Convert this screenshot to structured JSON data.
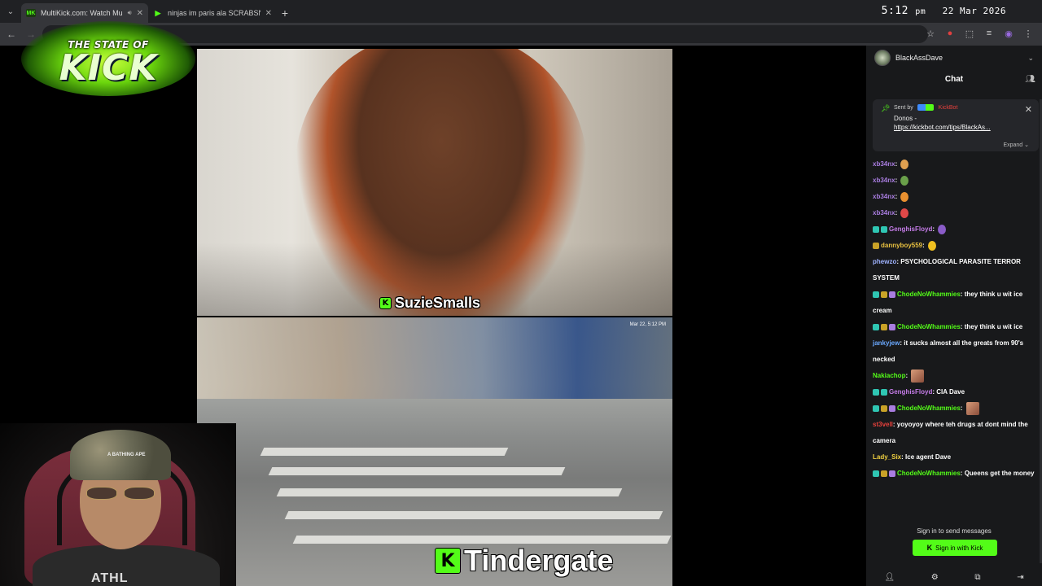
{
  "browser": {
    "tabs": [
      {
        "title": "MultiKick.com: Watch Multi",
        "favicon": "MK",
        "active": true
      },
      {
        "title": "ninjas im paris ala SCRABSNYC",
        "favicon": "play-icon",
        "active": false
      }
    ],
    "clock": {
      "time_hm": "5:12",
      "ampm": "pm",
      "date": "22 Mar 2026"
    }
  },
  "logo": {
    "top_text": "THE STATE OF",
    "big_text": "KICK"
  },
  "streams": {
    "top_name": "SuzieSmalls",
    "bottom_name": "Tindergate",
    "bottom_stamp": "Mar 22, 5:12 PM",
    "k_badge": "K"
  },
  "webcam": {
    "hat_text": "A BATHING APE",
    "shirt_text": "ATHL"
  },
  "chat": {
    "username": "BlackAssDave",
    "title": "Chat",
    "pinned": {
      "sent_by": "Sent by",
      "bot_name": "KickBot",
      "message": "Donos -",
      "link": "https://kickbot.com/tips/BlackAs...",
      "expand": "Expand"
    },
    "messages": [
      {
        "user": "xb34nx",
        "color": "#a97de0",
        "badges": [],
        "text": "",
        "emote": "#e0a050"
      },
      {
        "user": "xb34nx",
        "color": "#a97de0",
        "badges": [],
        "text": "",
        "emote": "#6aa04a"
      },
      {
        "user": "xb34nx",
        "color": "#a97de0",
        "badges": [],
        "text": "",
        "emote": "#e89030"
      },
      {
        "user": "xb34nx",
        "color": "#a97de0",
        "badges": [],
        "text": "",
        "emote": "#e04848"
      },
      {
        "user": "GenghisFloyd",
        "color": "#c57ce8",
        "badges": [
          "teal",
          "teal"
        ],
        "text": "",
        "emote": "#8a5cc8"
      },
      {
        "user": "dannyboy559",
        "color": "#e8c040",
        "badges": [
          "gold"
        ],
        "text": "",
        "emote": "#f0c020"
      },
      {
        "user": "phewzo",
        "color": "#9fb3ff",
        "badges": [],
        "text": "PSYCHOLOGICAL PARASITE TERROR SYSTEM",
        "emote": ""
      },
      {
        "user": "ChodeNoWhammies",
        "color": "#53fc18",
        "badges": [
          "teal",
          "gold",
          "purple"
        ],
        "text": "they think u wit ice cream",
        "emote": ""
      },
      {
        "user": "ChodeNoWhammies",
        "color": "#53fc18",
        "badges": [
          "teal",
          "gold",
          "purple"
        ],
        "text": "they think u wit ice",
        "emote": ""
      },
      {
        "user": "jankyjew",
        "color": "#6aa8ff",
        "badges": [],
        "text": "it sucks almost all the greats from 90's necked",
        "emote": ""
      },
      {
        "user": "Nakiachop",
        "color": "#53fc18",
        "badges": [],
        "text": "",
        "emote": "square"
      },
      {
        "user": "GenghisFloyd",
        "color": "#c57ce8",
        "badges": [
          "teal",
          "teal"
        ],
        "text": "CIA Dave",
        "emote": ""
      },
      {
        "user": "ChodeNoWhammies",
        "color": "#53fc18",
        "badges": [
          "teal",
          "gold",
          "purple"
        ],
        "text": "",
        "emote": "square"
      },
      {
        "user": "st3vell",
        "color": "#e8413c",
        "badges": [],
        "text": "yoyoyoy where teh drugs at dont mind the camera",
        "emote": ""
      },
      {
        "user": "Lady_Six",
        "color": "#f0d040",
        "badges": [],
        "text": "Ice agent Dave",
        "emote": ""
      },
      {
        "user": "ChodeNoWhammies",
        "color": "#53fc18",
        "badges": [
          "teal",
          "gold",
          "purple"
        ],
        "text": "Queens get the money",
        "emote": ""
      }
    ],
    "signin_prompt": "Sign in to send messages",
    "signin_button": "Sign in with Kick"
  },
  "colors": {
    "kick_green": "#53fc18",
    "chat_bg": "#18191b",
    "chrome_dark": "#202124"
  }
}
